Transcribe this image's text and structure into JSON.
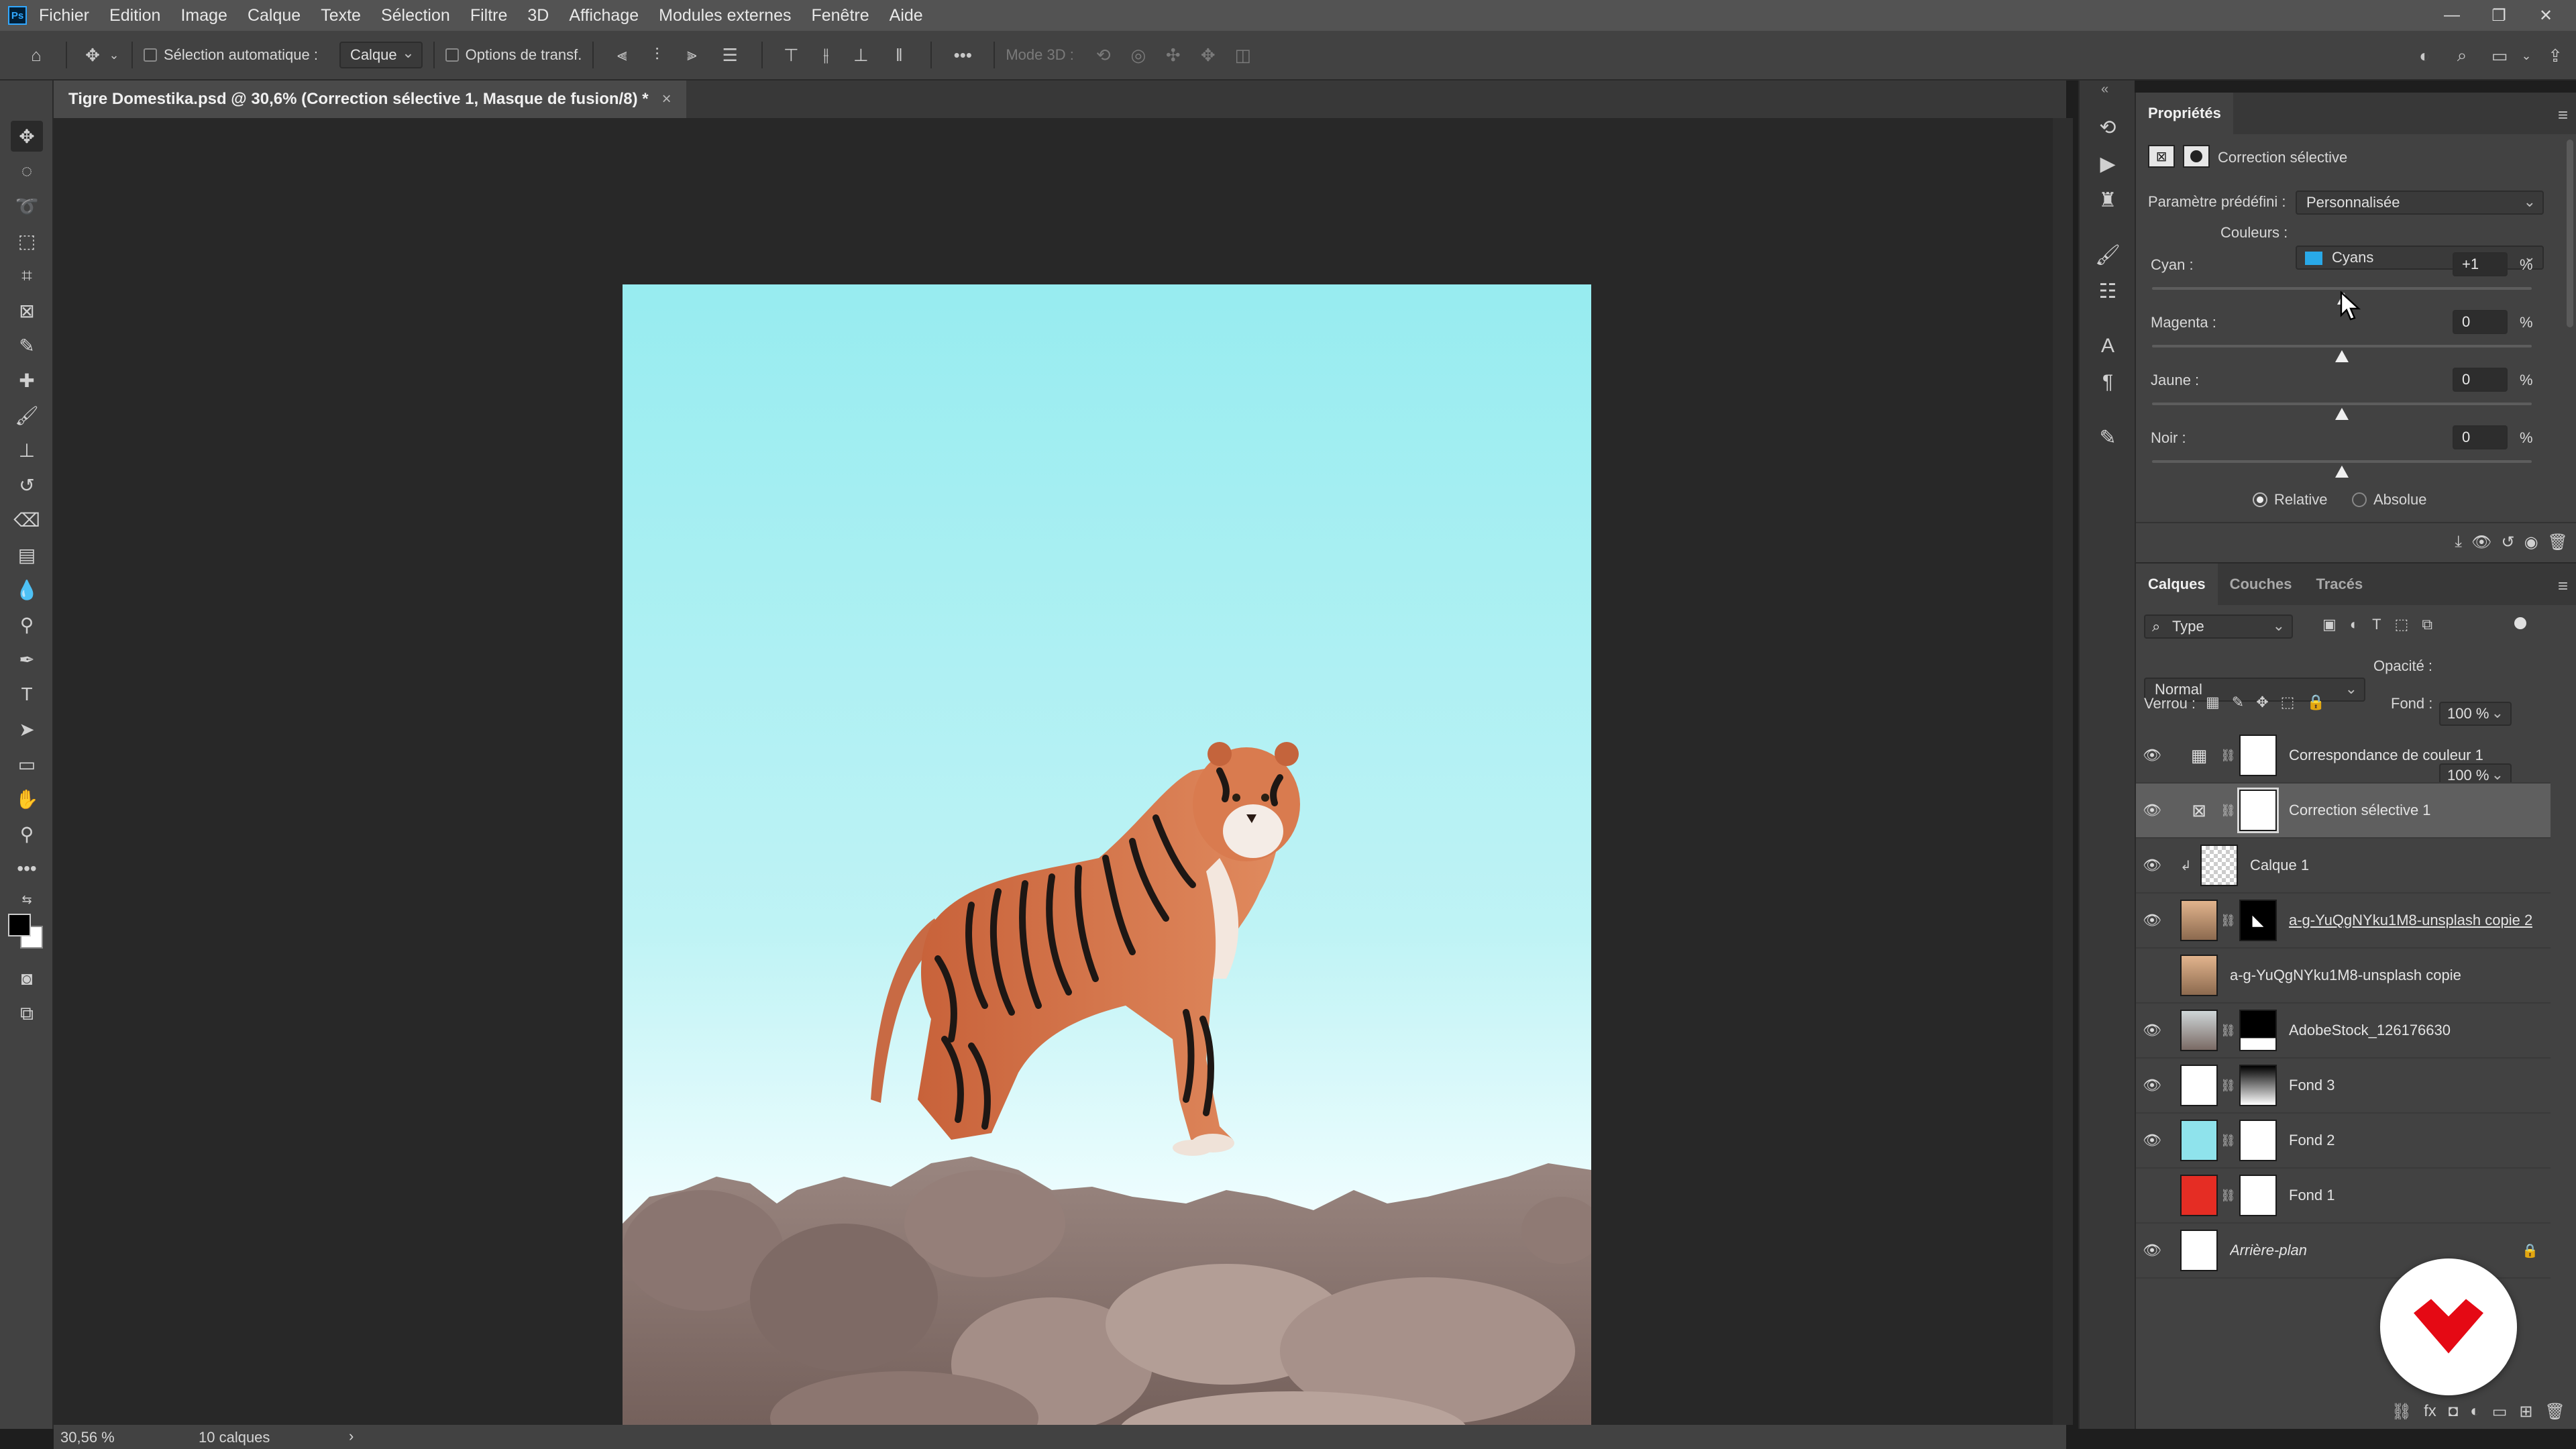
{
  "menubar": {
    "items": [
      "Fichier",
      "Edition",
      "Image",
      "Calque",
      "Texte",
      "Sélection",
      "Filtre",
      "3D",
      "Affichage",
      "Modules externes",
      "Fenêtre",
      "Aide"
    ],
    "logo": "Ps"
  },
  "options": {
    "auto_select_label": "Sélection automatique :",
    "auto_select_target": "Calque",
    "transform_label": "Options de transf.",
    "mode3d_label": "Mode 3D :"
  },
  "document": {
    "tab_title": "Tigre Domestika.psd @ 30,6% (Correction sélective 1, Masque de fusion/8) *",
    "close_glyph": "×"
  },
  "status": {
    "zoom": "30,56 %",
    "layers_count": "10 calques",
    "arrow": "›"
  },
  "properties": {
    "tab": "Propriétés",
    "adjustment_name": "Correction sélective",
    "preset_label": "Paramètre prédéfini :",
    "preset_value": "Personnalisée",
    "colors_label": "Couleurs :",
    "colors_value": "Cyans",
    "colors_swatch": "#29a9e8",
    "sliders": [
      {
        "label": "Cyan :",
        "value": "+1",
        "unit": "%",
        "level": 1
      },
      {
        "label": "Magenta :",
        "value": "0",
        "unit": "%",
        "level": 0
      },
      {
        "label": "Jaune :",
        "value": "0",
        "unit": "%",
        "level": 0
      },
      {
        "label": "Noir :",
        "value": "0",
        "unit": "%",
        "level": 0
      }
    ],
    "method_relative": "Relative",
    "method_absolute": "Absolue",
    "method_selected": "Relative"
  },
  "layers": {
    "tabs": [
      "Calques",
      "Couches",
      "Tracés"
    ],
    "filter_type": "Type",
    "blend_mode": "Normal",
    "opacity_label": "Opacité :",
    "opacity_value": "100 %",
    "lock_label": "Verrou :",
    "fill_label": "Fond :",
    "fill_value": "100 %",
    "items": [
      {
        "name": "Correspondance de couleur 1",
        "visible": true,
        "kind": "adjust-grid",
        "mask": "#ffffff",
        "selected": false
      },
      {
        "name": "Correction sélective 1",
        "visible": true,
        "kind": "adjust-selective",
        "mask": "#ffffff",
        "selected": true
      },
      {
        "name": "Calque 1",
        "visible": true,
        "kind": "transparent",
        "clipped": true,
        "selected": false
      },
      {
        "name": "a-g-YuQgNYku1M8-unsplash copie 2",
        "visible": true,
        "kind": "photo",
        "mask": "#000000",
        "selected": false,
        "underline": true
      },
      {
        "name": "a-g-YuQgNYku1M8-unsplash copie",
        "visible": false,
        "kind": "photo",
        "selected": false
      },
      {
        "name": "AdobeStock_126176630",
        "visible": true,
        "kind": "photo-rocks",
        "mask": "#000000",
        "selected": false
      },
      {
        "name": "Fond 3",
        "visible": true,
        "kind": "color",
        "color": "#ffffff",
        "mask": "gradient",
        "selected": false
      },
      {
        "name": "Fond 2",
        "visible": true,
        "kind": "color",
        "color": "#8fe3ec",
        "mask": "#ffffff",
        "selected": false
      },
      {
        "name": "Fond 1",
        "visible": false,
        "kind": "color",
        "color": "#e52d24",
        "mask": "#ffffff",
        "selected": false
      },
      {
        "name": "Arrière-plan",
        "visible": true,
        "kind": "color",
        "color": "#ffffff",
        "locked": true,
        "italic": true,
        "selected": false
      }
    ]
  },
  "colors": {
    "foreground": "#000000",
    "background": "#ffffff",
    "brand": "#e50914"
  }
}
